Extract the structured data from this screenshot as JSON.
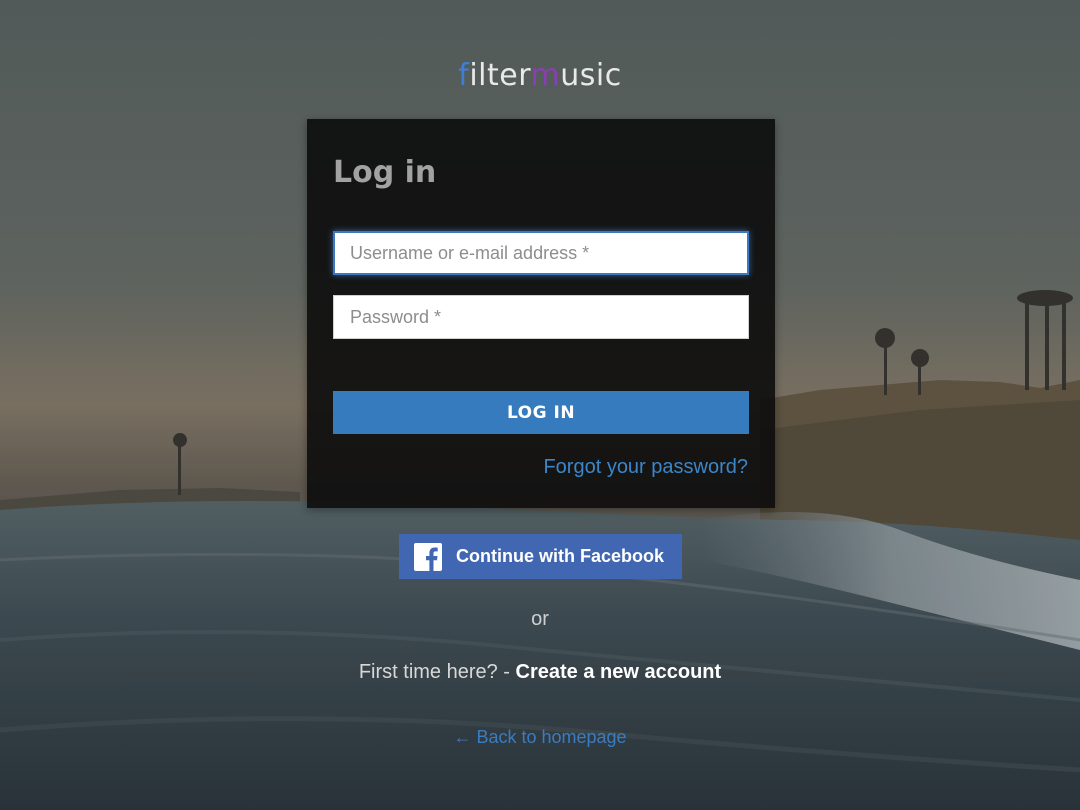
{
  "brand": {
    "logo_text_f": "f",
    "logo_text_ilter": "ilter",
    "logo_text_m": "m",
    "logo_text_usic": "usic"
  },
  "login": {
    "title": "Log in",
    "username_placeholder": "Username or e-mail address *",
    "username_value": "",
    "password_placeholder": "Password *",
    "password_value": "",
    "submit_label": "LOG IN",
    "forgot_label": "Forgot your password?"
  },
  "social": {
    "facebook_label": "Continue with Facebook"
  },
  "separator": {
    "or_label": "or"
  },
  "signup": {
    "prompt": "First time here? - ",
    "link_label": "Create a new account"
  },
  "footer": {
    "back_label": "← Back to homepage"
  },
  "colors": {
    "primary_button": "#377bbf",
    "facebook": "#4267b2",
    "link": "#3b86c9",
    "panel_bg": "#0c0c0c"
  },
  "icons": {
    "facebook": "facebook-icon"
  }
}
